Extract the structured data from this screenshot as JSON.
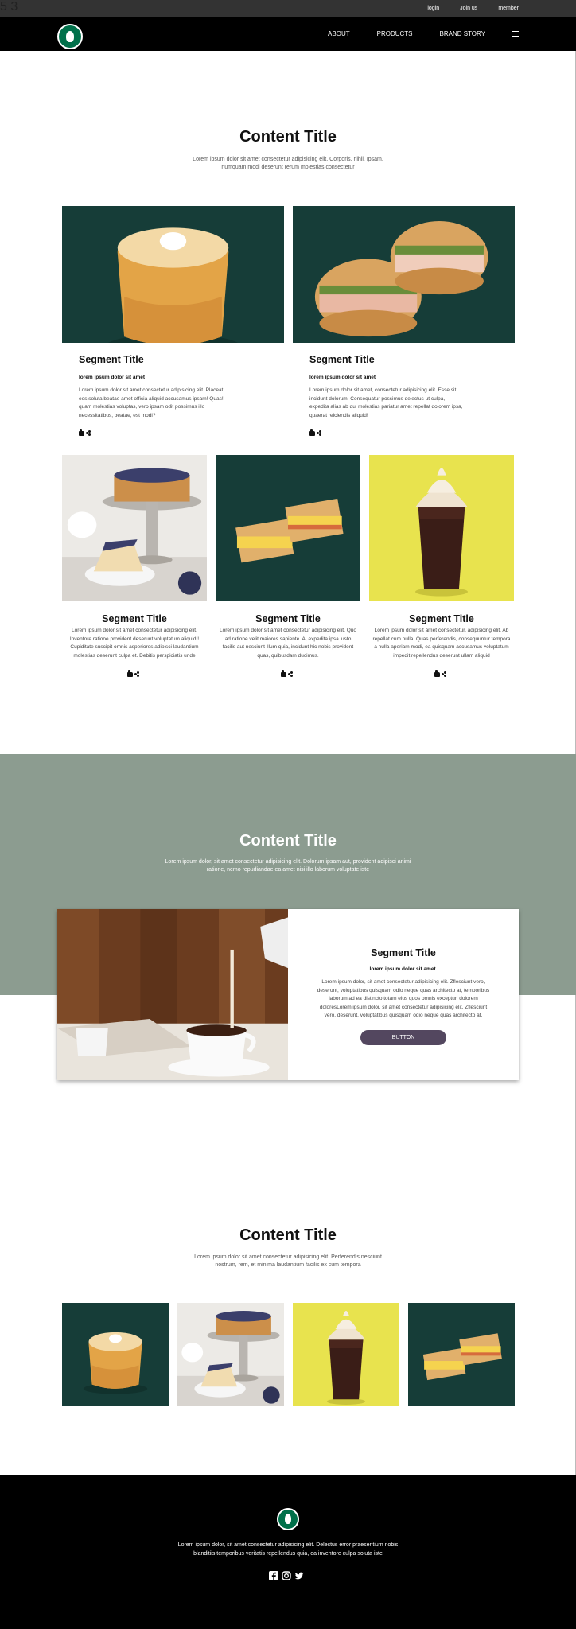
{
  "topbar": {
    "logos": [
      "html5-icon",
      "css3-icon"
    ],
    "links": [
      "login",
      "Join us",
      "member"
    ]
  },
  "nav": {
    "logo": "starbucks-logo",
    "links": [
      "ABOUT",
      "PRODUCTS",
      "BRAND STORY"
    ],
    "menu_icon": "hamburger-icon"
  },
  "section1": {
    "title": "Content Title",
    "subtitle": "Lorem ipsum dolor sit amet consectetur adipisicing elit. Corporis, nihil. Ipsam, numquam modi deserunt rerum molestias consectetur",
    "cards_large": [
      {
        "image": "chiffon-cake",
        "title": "Segment Title",
        "lead": "lorem ipsum dolor sit amet",
        "text": "Lorem ipsum dolor sit amet consectetur adipisicing elit. Placeat eos soluta beatae amet officia aliquid accusamus ipsam! Quas! quam molestias voluptas, vero ipsam odit possimus illo necessitatibus, beatae, est modi?"
      },
      {
        "image": "bagel-sandwich",
        "title": "Segment Title",
        "lead": "lorem ipsum dolor sit amet",
        "text": "Lorem ipsum dolor sit amet, consectetur adipisicing elit. Esse sit incidunt dolorum. Consequatur possimus delectus ut culpa, expedita alias ab qui molestias pariatur amet repellat dolorem ipsa, quaerat reiciendis aliquid!"
      }
    ],
    "cards_small": [
      {
        "image": "blueberry-cheesecake",
        "title": "Segment Title",
        "text": "Lorem ipsum dolor sit amet consectetur adipisicing elit. Inventore ratione provident deserunt voluptatum aliquid!! Cupiditate suscipit omnis asperiores adipisci laudantium molestias deserunt culpa et. Debitis perspiciatis unde"
      },
      {
        "image": "egg-sandwich",
        "title": "Segment Title",
        "text": "Lorem ipsum dolor sit amet consectetur adipisicing elit. Quo ad ratione velit maiores sapiente. A, expedita ipsa iusto facilis aut nesciunt illum quia, incidunt hic nobis provident quas, quibusdam ducimus."
      },
      {
        "image": "chocolate-frappuccino",
        "title": "Segment Title",
        "text": "Lorem ipsum dolor sit amet consectetur, adipisicing elit. Ab repellat cum nulla. Quas perferendis, consequuntur tempora a nulla aperiam modi, ea quisquam accusamus voluptatum impedit repellendus deserunt ullam aliquid"
      }
    ]
  },
  "section2": {
    "title": "Content Title",
    "subtitle": "Lorem ipsum dolor, sit amet consectetur adipisicing elit. Dolorum ipsam aut, provident adipisci animi ratione, nemo repudiandae ea amet nisi illo laborum voluptate iste",
    "feature": {
      "image": "coffee-pour",
      "title": "Segment Title",
      "lead": "lorem ipsum dolor sit amet.",
      "text": "Lorem ipsum dolor, sit amet consectetur adipisicing elit. Zflesciunt vero, deserunt, voluptatibus quisquam odio neque quas architecto at, temporibus laborum ad ea distincto totam eius quos omnis excepturi dolorem doloresLorem ipsum dolor, sit amet consectetur adipisicing elit. Zflesciunt vero, deserunt, voluptatibus quisquam odio neque quas architecto at.",
      "button": "BUTTON"
    }
  },
  "section3": {
    "title": "Content Title",
    "subtitle": "Lorem ipsum dolor sit amet consectetur adipisicing elit. Perferendis nesciunt nostrum, rem, et minima laudantium facilis ex cum tempora",
    "gallery": [
      "chiffon-cake",
      "blueberry-cheesecake",
      "chocolate-frappuccino",
      "egg-sandwich"
    ]
  },
  "footer": {
    "logo": "starbucks-logo",
    "text": "Lorem ipsum dolor, sit amet consectetur adipisicing elit. Delectus error praesentium nobis blanditiis temporibus veritatis repellendus quia, ea inventore culpa soluta iste",
    "social": [
      "facebook-icon",
      "instagram-icon",
      "twitter-icon"
    ]
  },
  "colors": {
    "dark_green": "#163d38",
    "sage": "#8c9c90",
    "button": "#53475f",
    "yellow": "#e8e34e"
  }
}
